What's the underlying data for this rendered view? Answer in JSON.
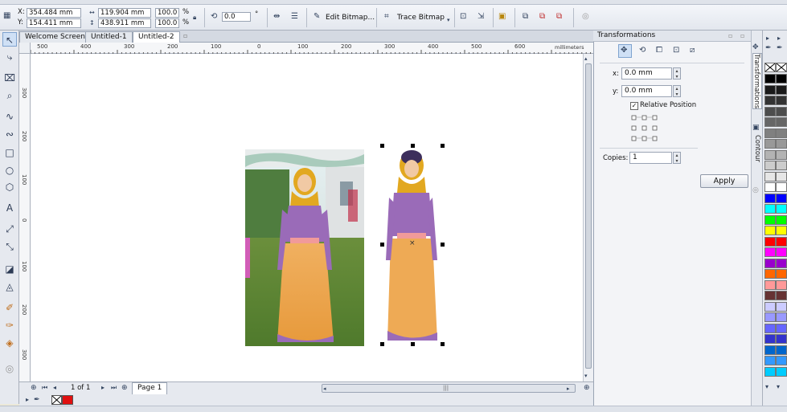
{
  "propbar": {
    "x_label": "X:",
    "x_value": "354.484 mm",
    "y_label": "Y:",
    "y_value": "154.411 mm",
    "w_value": "119.904 mm",
    "h_value": "438.911 mm",
    "scale_w": "100.0",
    "scale_h": "100.0",
    "pct1": "%",
    "pct2": "%",
    "rotation": "0.0",
    "deg": "°",
    "edit_bitmap": "Edit Bitmap...",
    "trace_bitmap": "Trace Bitmap"
  },
  "tabs": [
    {
      "label": "Welcome Screen"
    },
    {
      "label": "Untitled-1"
    },
    {
      "label": "Untitled-2"
    }
  ],
  "ruler": {
    "h_ticks": [
      "500",
      "400",
      "300",
      "200",
      "100",
      "0",
      "100",
      "200",
      "300",
      "400",
      "500",
      "600"
    ],
    "v_ticks": [
      "300",
      "200",
      "100",
      "0",
      "100",
      "200",
      "300"
    ],
    "unit": "millimeters"
  },
  "nav": {
    "page_count": "1 of 1",
    "page_tab": "Page 1"
  },
  "docker": {
    "title": "Transformations",
    "x_label": "x:",
    "x_value": "0.0 mm",
    "y_label": "y:",
    "y_value": "0.0 mm",
    "relative_position": "Relative Position",
    "copies_label": "Copies:",
    "copies_value": "1",
    "apply": "Apply"
  },
  "docker_tabs": [
    "Transformations",
    "Contour"
  ],
  "colors": {
    "accent": "#cfe0f5",
    "palette": [
      "#000000",
      "#1a1a1a",
      "#333333",
      "#4d4d4d",
      "#666666",
      "#808080",
      "#999999",
      "#b3b3b3",
      "#cccccc",
      "#e6e6e6",
      "#ffffff",
      "#0000ff",
      "#00ffff",
      "#00ff00",
      "#ffff00",
      "#ff0000",
      "#ff00ff",
      "#9900cc",
      "#ff6600",
      "#ff9999",
      "#663333",
      "#ccccff",
      "#9999ff",
      "#6666ff",
      "#3333cc",
      "#0066cc",
      "#3399ff",
      "#00ccff"
    ]
  }
}
